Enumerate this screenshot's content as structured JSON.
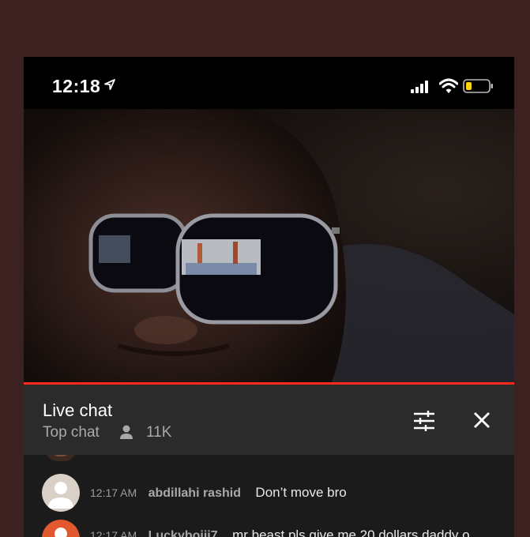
{
  "status_bar": {
    "time": "12:18"
  },
  "live_chat": {
    "title": "Live chat",
    "mode": "Top chat",
    "viewer_count": "11K"
  },
  "messages": [
    {
      "time": "12:17 AM",
      "author": "abdillahi rashid",
      "text": "Don’t move bro",
      "avatar_color": "#d9d0c7"
    },
    {
      "time": "12:17 AM",
      "author": "Luckyboiii7",
      "text": "mr beast pls give me 20 dollars daddy o",
      "avatar_color": "#e2592f"
    }
  ],
  "colors": {
    "background": "#3b2220",
    "progress": "#ff2a1c",
    "header_bg": "#2b2b2b",
    "chat_bg": "#1b1b1b"
  }
}
